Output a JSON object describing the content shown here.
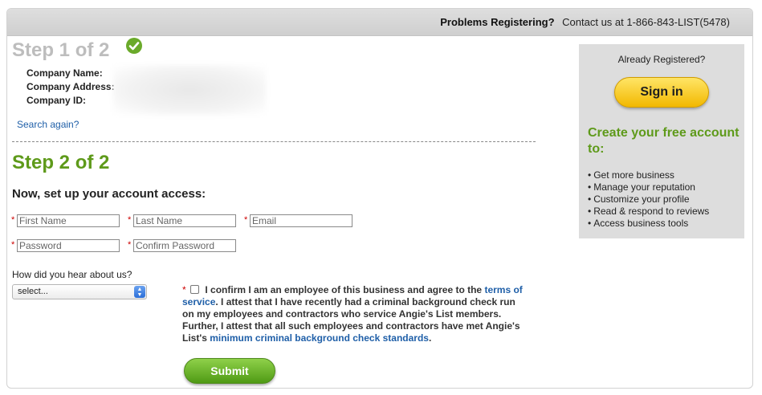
{
  "topbar": {
    "problems_label": "Problems Registering?",
    "contact_text": "Contact us at 1-866-843-LIST(5478)"
  },
  "step1": {
    "title": "Step 1 of 2",
    "labels": [
      "Company Name:",
      "Company Address:",
      "Company ID:"
    ],
    "search_again": "Search again?"
  },
  "step2": {
    "title": "Step 2 of 2",
    "subheading": "Now, set up your account access:",
    "fields": {
      "first_name": "First Name",
      "last_name": "Last Name",
      "email": "Email",
      "password": "Password",
      "confirm_password": "Confirm Password"
    },
    "required_mark": "*",
    "hear_label": "How did you hear about us?",
    "hear_select_value": "select...",
    "confirm_text_1": "I confirm I am an employee of this business and agree to the",
    "terms_link": "terms of service",
    "confirm_text_2": ". I attest that I have recently had a criminal background check run on my employees and contractors who service Angie's List members. Further, I attest that all such employees and contractors have met Angie's List's",
    "standards_link": "minimum criminal background check standards",
    "confirm_text_3": ".",
    "submit_label": "Submit"
  },
  "sidebar": {
    "already_registered": "Already Registered?",
    "sign_in_label": "Sign in",
    "create_title": "Create your free account to:",
    "benefits": [
      "Get more business",
      "Manage your reputation",
      "Customize your profile",
      "Read & respond to reviews",
      "Access business tools"
    ]
  },
  "colors": {
    "green": "#5e9a1a",
    "link_blue": "#1f5fa8",
    "required_red": "#cc0000",
    "signin_yellow": "#f2b800"
  }
}
